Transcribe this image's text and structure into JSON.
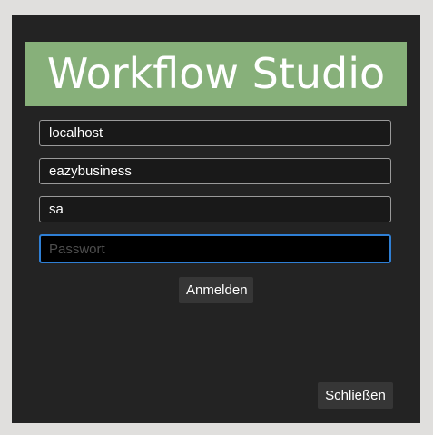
{
  "window": {
    "title": "Workflow Studio"
  },
  "form": {
    "server": {
      "value": "localhost",
      "placeholder": ""
    },
    "database": {
      "value": "eazybusiness",
      "placeholder": ""
    },
    "user": {
      "value": "sa",
      "placeholder": ""
    },
    "password": {
      "value": "",
      "placeholder": "Passwort"
    }
  },
  "actions": {
    "login_label": "Anmelden",
    "close_label": "Schließen"
  },
  "colors": {
    "banner": "#87b07a",
    "background": "#232323",
    "focus_border": "#2f7fd4"
  }
}
